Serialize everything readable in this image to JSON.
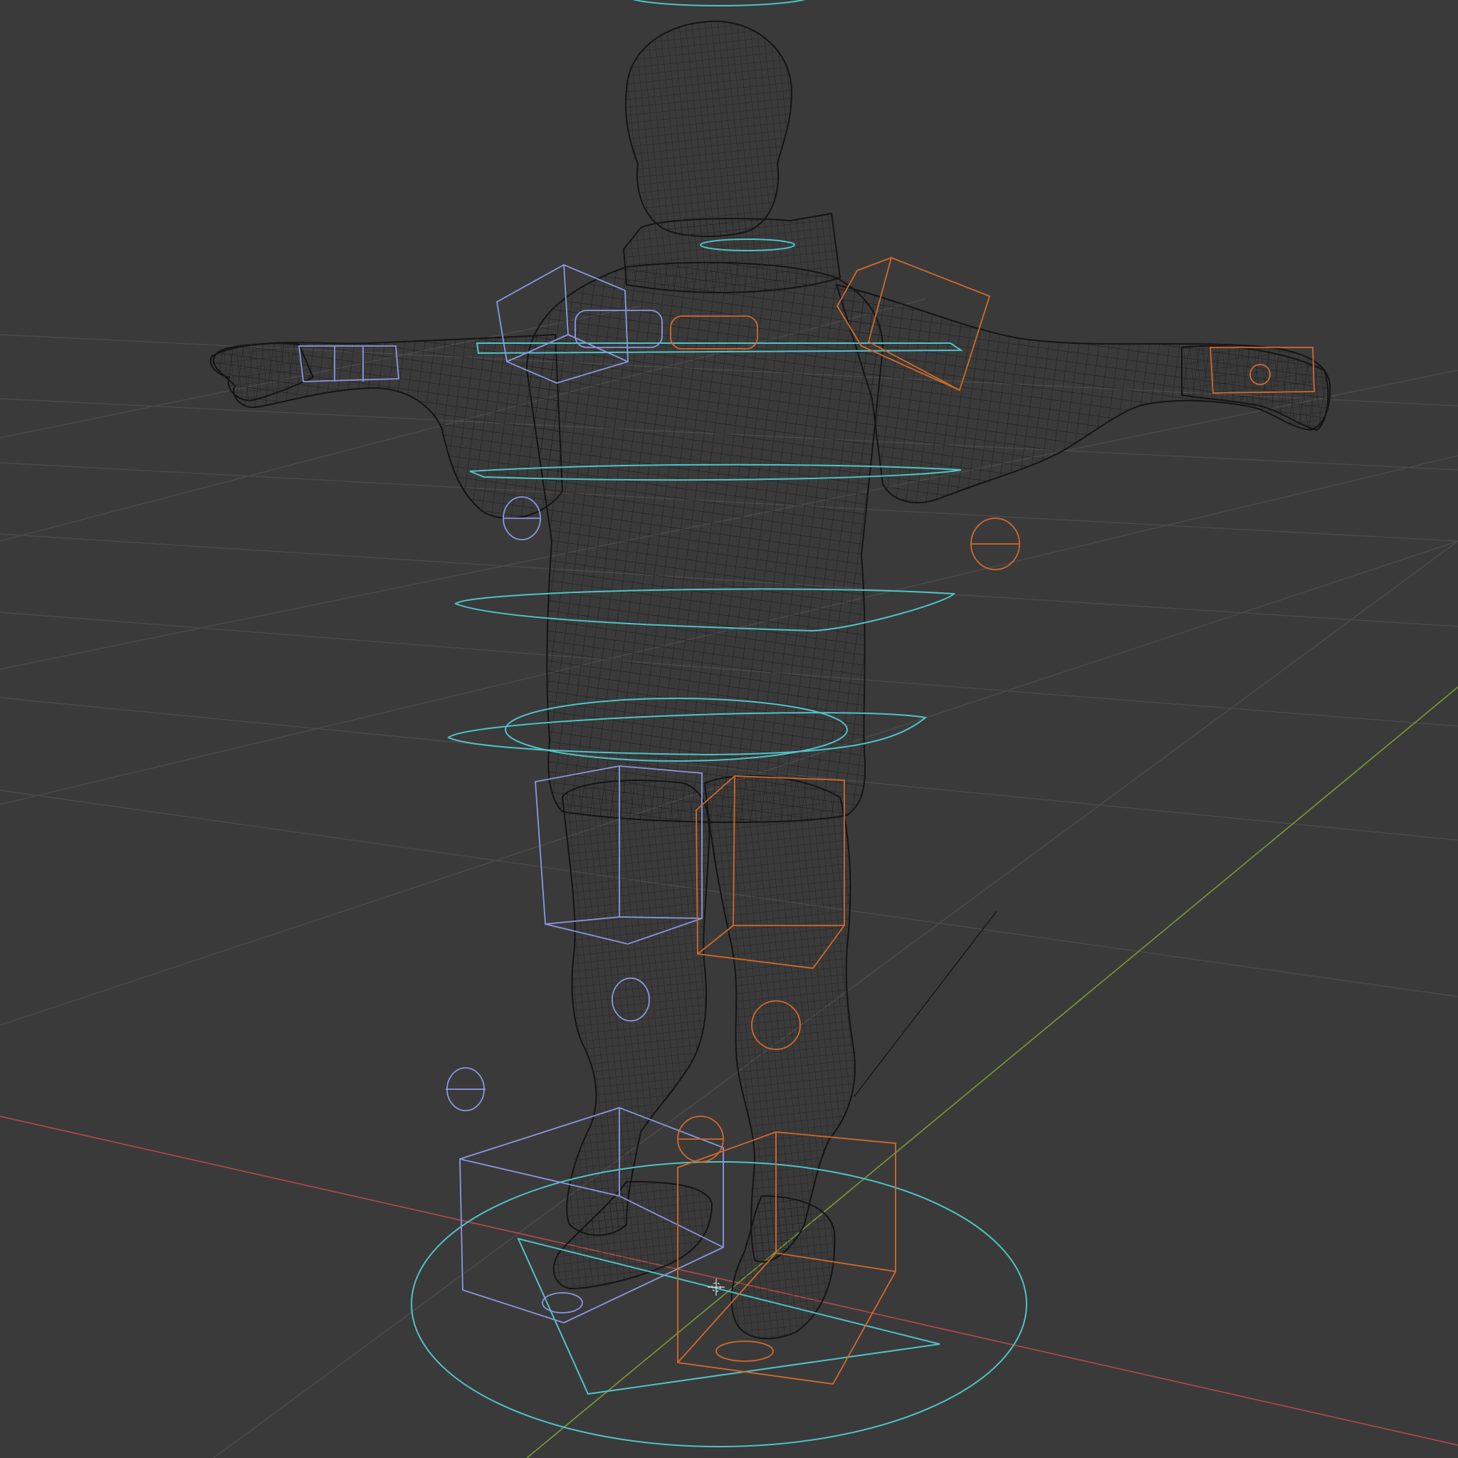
{
  "scene": {
    "view": "3d-viewport",
    "shading": "wireframe",
    "subject": "rigged-character-t-pose",
    "background_color": "#3a3a3a",
    "grid_color": "#4b4b4b",
    "axis_x_color": "#b34a4a",
    "axis_y_color": "#7a9a32",
    "mesh_wire_color": "#141414",
    "control_center_color": "#4fc3c8",
    "control_left_color": "#8a97e0",
    "control_right_color": "#d2692a"
  }
}
